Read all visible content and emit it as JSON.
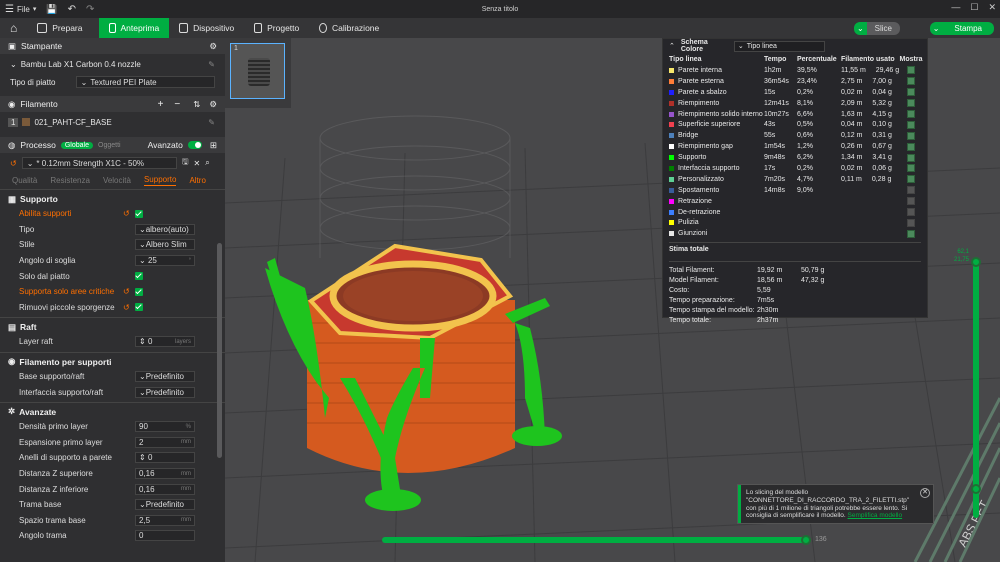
{
  "window": {
    "title": "Senza titolo",
    "file_menu": "File"
  },
  "menu": {
    "tabs": [
      {
        "label": "Prepara"
      },
      {
        "label": "Anteprima"
      },
      {
        "label": "Dispositivo"
      },
      {
        "label": "Progetto"
      },
      {
        "label": "Calibrazione"
      }
    ],
    "slice_label": "Slice",
    "print_label": "Stampa"
  },
  "sidebar": {
    "printer_section": "Stampante",
    "printer_name": "Bambu Lab X1 Carbon 0.4 nozzle",
    "plate_label": "Tipo di piatto",
    "plate_value": "Textured PEI Plate",
    "filament_section": "Filamento",
    "filament_index": "1",
    "filament_name": "021_PAHT-CF_BASE",
    "process_section": "Processo",
    "process_global": "Globale",
    "process_objects": "Oggetti",
    "advanced_label": "Avanzato",
    "process_preset": "* 0.12mm Strength X1C - 50%",
    "subtabs": [
      "Qualità",
      "Resistenza",
      "Velocità",
      "Supporto",
      "Altro"
    ],
    "groups": {
      "support": "Supporto",
      "raft": "Raft",
      "filament_support": "Filamento per supporti",
      "advanced": "Avanzate"
    },
    "params": {
      "enable_support": "Abilita supporti",
      "type": {
        "label": "Tipo",
        "value": "albero(auto)"
      },
      "style": {
        "label": "Stile",
        "value": "Albero Slim"
      },
      "threshold": {
        "label": "Angolo di soglia",
        "value": "25",
        "unit": "°"
      },
      "on_build_plate": "Solo dal piatto",
      "critical_only": "Supporta solo aree critiche",
      "remove_small": "Rimuovi piccole sporgenze",
      "raft_layers": {
        "label": "Layer raft",
        "value": "0",
        "unit": "layers"
      },
      "base_fil": {
        "label": "Base supporto/raft",
        "value": "Predefinito"
      },
      "iface_fil": {
        "label": "Interfaccia supporto/raft",
        "value": "Predefinito"
      },
      "first_density": {
        "label": "Densità primo layer",
        "value": "90",
        "unit": "%"
      },
      "first_expansion": {
        "label": "Espansione primo layer",
        "value": "2",
        "unit": "mm"
      },
      "wall_loops": {
        "label": "Anelli di supporto a parete",
        "value": "0"
      },
      "top_z": {
        "label": "Distanza Z superiore",
        "value": "0,16",
        "unit": "mm"
      },
      "bottom_z": {
        "label": "Distanza Z inferiore",
        "value": "0,16",
        "unit": "mm"
      },
      "base_pattern": {
        "label": "Trama base",
        "value": "Predefinito"
      },
      "pattern_spacing": {
        "label": "Spazio trama base",
        "value": "2,5",
        "unit": "mm"
      },
      "pattern_angle": {
        "label": "Angolo trama",
        "value": "0"
      }
    }
  },
  "legend": {
    "title": "Schema Colore",
    "dropdown": "Tipo linea",
    "columns": [
      "Tipo linea",
      "Tempo",
      "Percentuale",
      "Filamento usato",
      "Mostra"
    ],
    "rows": [
      {
        "name": "Parete interna",
        "color": "#f7e66c",
        "time": "1h2m",
        "pct": "39,5%",
        "fil_m": "11,55 m",
        "fil_g": "29,46 g",
        "show": true
      },
      {
        "name": "Parete esterna",
        "color": "#ff7d38",
        "time": "36m54s",
        "pct": "23,4%",
        "fil_m": "2,75 m",
        "fil_g": "7,00 g",
        "show": true
      },
      {
        "name": "Parete a sbalzo",
        "color": "#1f1fff",
        "time": "15s",
        "pct": "0,2%",
        "fil_m": "0,02 m",
        "fil_g": "0,04 g",
        "show": true
      },
      {
        "name": "Riempimento",
        "color": "#b03029",
        "time": "12m41s",
        "pct": "8,1%",
        "fil_m": "2,09 m",
        "fil_g": "5,32 g",
        "show": true
      },
      {
        "name": "Riempimento solido interno",
        "color": "#9654cc",
        "time": "10m27s",
        "pct": "6,6%",
        "fil_m": "1,63 m",
        "fil_g": "4,15 g",
        "show": true
      },
      {
        "name": "Superficie superiore",
        "color": "#f0404f",
        "time": "43s",
        "pct": "0,5%",
        "fil_m": "0,04 m",
        "fil_g": "0,10 g",
        "show": true
      },
      {
        "name": "Bridge",
        "color": "#4d80ba",
        "time": "55s",
        "pct": "0,6%",
        "fil_m": "0,12 m",
        "fil_g": "0,31 g",
        "show": true
      },
      {
        "name": "Riempimento gap",
        "color": "#ffffff",
        "time": "1m54s",
        "pct": "1,2%",
        "fil_m": "0,26 m",
        "fil_g": "0,67 g",
        "show": true
      },
      {
        "name": "Supporto",
        "color": "#00ff00",
        "time": "9m48s",
        "pct": "6,2%",
        "fil_m": "1,34 m",
        "fil_g": "3,41 g",
        "show": true
      },
      {
        "name": "Interfaccia supporto",
        "color": "#008000",
        "time": "17s",
        "pct": "0,2%",
        "fil_m": "0,02 m",
        "fil_g": "0,06 g",
        "show": true
      },
      {
        "name": "Personalizzato",
        "color": "#5ed194",
        "time": "7m20s",
        "pct": "4,7%",
        "fil_m": "0,11 m",
        "fil_g": "0,28 g",
        "show": true
      },
      {
        "name": "Spostamento",
        "color": "#385c9b",
        "time": "14m8s",
        "pct": "9,0%",
        "fil_m": "",
        "fil_g": "",
        "show": false
      },
      {
        "name": "Retrazione",
        "color": "#ff00ff",
        "time": "",
        "pct": "",
        "fil_m": "",
        "fil_g": "",
        "show": false
      },
      {
        "name": "De-retrazione",
        "color": "#3c7fff",
        "time": "",
        "pct": "",
        "fil_m": "",
        "fil_g": "",
        "show": false
      },
      {
        "name": "Pulizia",
        "color": "#ffff00",
        "time": "",
        "pct": "",
        "fil_m": "",
        "fil_g": "",
        "show": false
      },
      {
        "name": "Giunzioni",
        "color": "#e6e6e6",
        "time": "",
        "pct": "",
        "fil_m": "",
        "fil_g": "",
        "show": true
      }
    ],
    "estimate_title": "Stima totale",
    "stats": [
      {
        "k": "Total Filament:",
        "v1": "19,92 m",
        "v2": "50,79 g"
      },
      {
        "k": "Model Filament:",
        "v1": "18,56 m",
        "v2": "47,32 g"
      },
      {
        "k": "Costo:",
        "v1": "5,59",
        "v2": ""
      },
      {
        "k": "Tempo preparazione:",
        "v1": "7m5s",
        "v2": ""
      },
      {
        "k": "Tempo stampa del modello:",
        "v1": "2h30m",
        "v2": ""
      },
      {
        "k": "Tempo totale:",
        "v1": "2h37m",
        "v2": ""
      }
    ]
  },
  "plate": {
    "index": "1"
  },
  "notification": {
    "text": "Lo slicing del modello \"CONNETTORE_DI_RACCORDO_TRA_2_FILETTI.stp\" con più di 1 milione di triangoli potrebbe essere lento. Si consiglia di semplificare il modello.",
    "link": "Semplifica modello"
  },
  "layer_slider": {
    "layer_top": "62,1",
    "layer_top_z": "21,75"
  },
  "bed_label": "ABS PET"
}
